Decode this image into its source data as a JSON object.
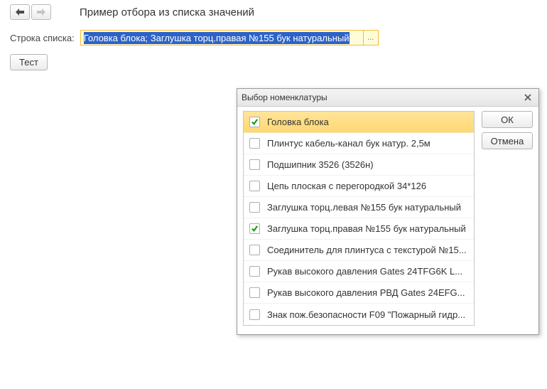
{
  "header": {
    "title": "Пример отбора из списка значений"
  },
  "field": {
    "label": "Строка списка:",
    "value": "Головка блока; Заглушка торц.правая №155 бук натуральный",
    "more": "..."
  },
  "buttons": {
    "test": "Тест"
  },
  "dialog": {
    "title": "Выбор номенклатуры",
    "ok": "ОК",
    "cancel": "Отмена",
    "items": [
      {
        "label": "Головка блока",
        "checked": true,
        "selected": true
      },
      {
        "label": "Плинтус кабель-канал бук натур. 2,5м",
        "checked": false,
        "selected": false
      },
      {
        "label": "Подшипник 3526 (3526н)",
        "checked": false,
        "selected": false
      },
      {
        "label": "Цепь плоская с перегородкой 34*126",
        "checked": false,
        "selected": false
      },
      {
        "label": "Заглушка торц.левая №155 бук натуральный",
        "checked": false,
        "selected": false
      },
      {
        "label": "Заглушка торц.правая №155 бук натуральный",
        "checked": true,
        "selected": false
      },
      {
        "label": "Соединитель для плинтуса с текстурой №15...",
        "checked": false,
        "selected": false
      },
      {
        "label": "Рукав высокого давления Gates 24TFG6K L...",
        "checked": false,
        "selected": false
      },
      {
        "label": "Рукав высокого давления РВД Gates 24EFG...",
        "checked": false,
        "selected": false
      },
      {
        "label": "Знак пож.безопасности F09 \"Пожарный гидр...",
        "checked": false,
        "selected": false
      }
    ]
  }
}
